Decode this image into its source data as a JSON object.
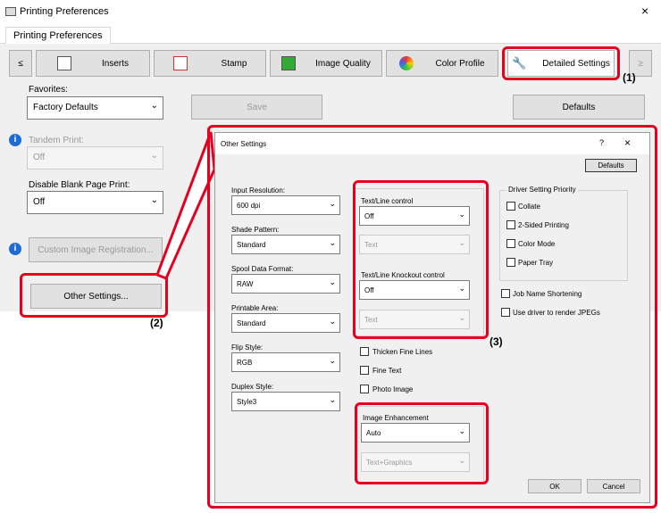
{
  "window": {
    "title": "Printing Preferences",
    "close": "×"
  },
  "tab": "Printing Preferences",
  "nav": {
    "prev": "≤",
    "inserts": "Inserts",
    "stamp": "Stamp",
    "image_quality": "Image Quality",
    "color_profile": "Color Profile",
    "detailed_settings": "Detailed Settings",
    "next": "≥"
  },
  "favorites": {
    "label": "Favorites:",
    "value": "Factory Defaults",
    "save": "Save",
    "defaults": "Defaults"
  },
  "tandem": {
    "label": "Tandem Print:",
    "value": "Off"
  },
  "disable_blank": {
    "label": "Disable Blank Page Print:",
    "value": "Off"
  },
  "custom_image": "Custom Image Registration...",
  "other_settings_button": "Other Settings...",
  "callouts": {
    "c1": "(1)",
    "c2": "(2)",
    "c3": "(3)"
  },
  "dialog": {
    "title": "Other Settings",
    "help": "?",
    "close": "×",
    "defaults": "Defaults",
    "input_resolution": {
      "label": "Input Resolution:",
      "value": "600 dpi"
    },
    "shade_pattern": {
      "label": "Shade Pattern:",
      "value": "Standard"
    },
    "spool": {
      "label": "Spool Data Format:",
      "value": "RAW"
    },
    "printable_area": {
      "label": "Printable Area:",
      "value": "Standard"
    },
    "flip_style": {
      "label": "Flip Style:",
      "value": "RGB"
    },
    "duplex_style": {
      "label": "Duplex Style:",
      "value": "Style3"
    },
    "text_line_control": {
      "label": "Text/Line control",
      "value": "Off",
      "sub": "Text"
    },
    "knockout": {
      "label": "Text/Line Knockout control",
      "value": "Off",
      "sub": "Text"
    },
    "thicken": "Thicken Fine Lines",
    "fine_text": "Fine Text",
    "photo_image": "Photo Image",
    "image_enhancement": {
      "label": "Image Enhancement",
      "value": "Auto",
      "sub": "Text+Graphics"
    },
    "driver_priority": {
      "label": "Driver Setting Priority",
      "items": [
        "Collate",
        "2-Sided Printing",
        "Color Mode",
        "Paper Tray"
      ]
    },
    "job_name": "Job Name Shortening",
    "use_driver_jpeg": "Use driver to render JPEGs",
    "ok": "OK",
    "cancel": "Cancel"
  }
}
